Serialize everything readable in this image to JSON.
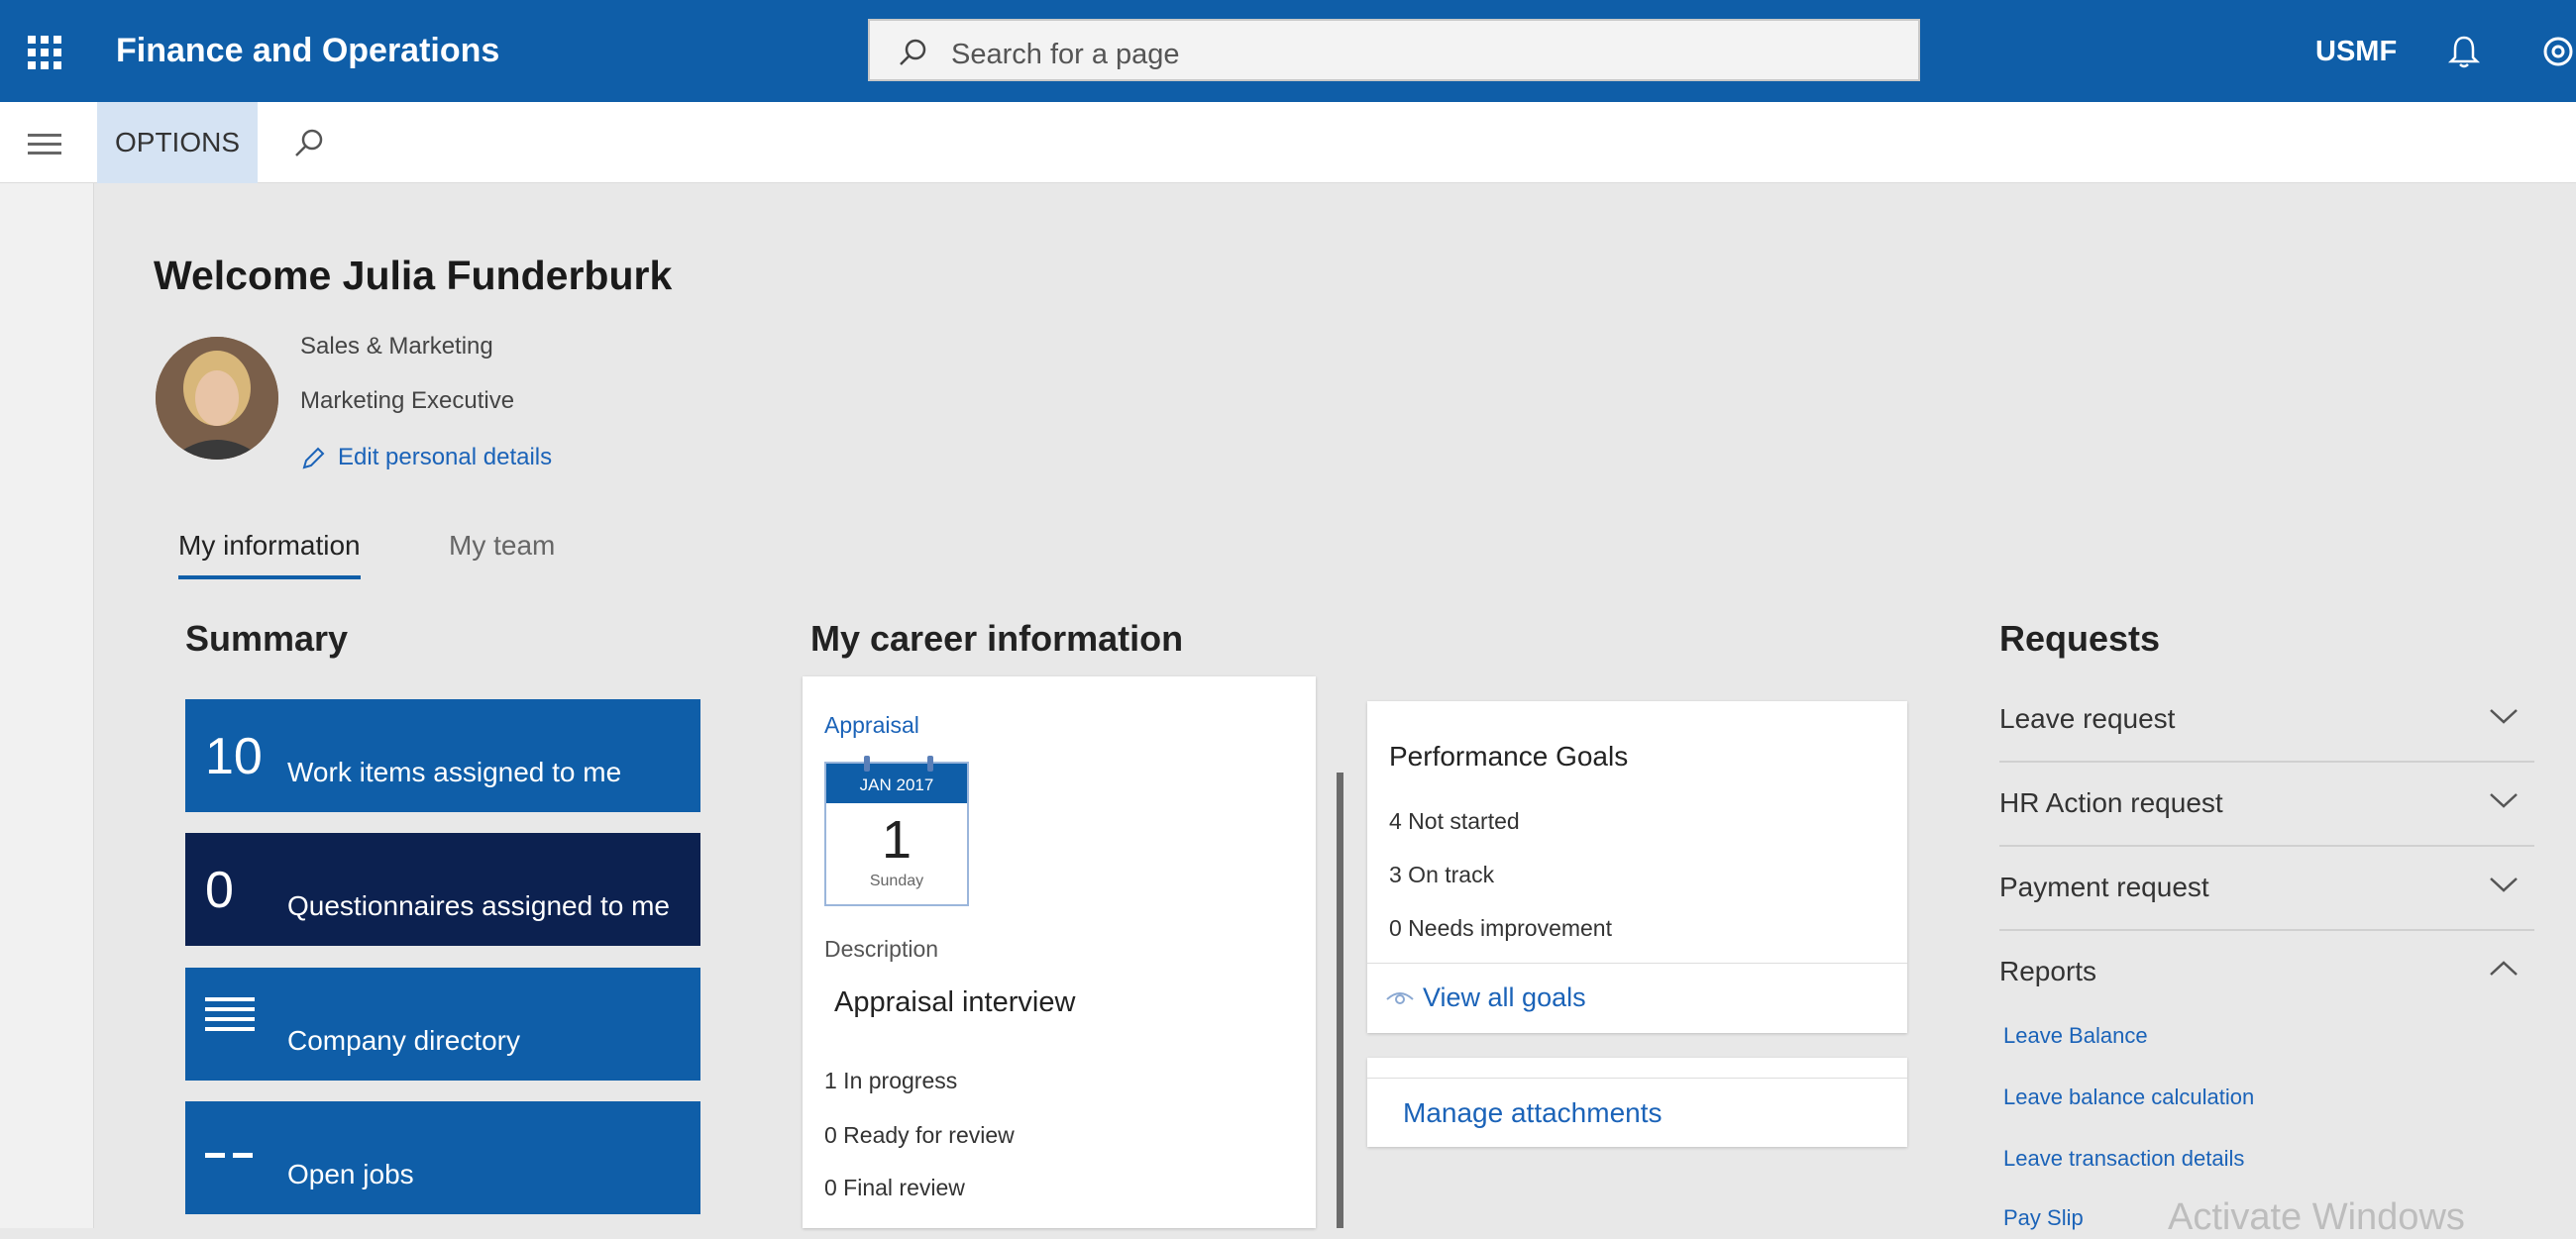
{
  "header": {
    "app_title": "Finance and Operations",
    "search_placeholder": "Search for a page",
    "company": "USMF"
  },
  "actionbar": {
    "options_label": "OPTIONS"
  },
  "profile": {
    "welcome": "Welcome Julia Funderburk",
    "department": "Sales & Marketing",
    "job_title": "Marketing Executive",
    "edit_link": "Edit personal details"
  },
  "tabs": [
    {
      "label": "My information",
      "active": true
    },
    {
      "label": "My team",
      "active": false
    }
  ],
  "summary": {
    "title": "Summary",
    "tiles": [
      {
        "count": "10",
        "label": "Work items assigned to me"
      },
      {
        "count": "0",
        "label": "Questionnaires assigned to me"
      },
      {
        "label": "Company directory"
      },
      {
        "label": "Open jobs"
      }
    ]
  },
  "career": {
    "title": "My career information",
    "appraisal": {
      "link": "Appraisal",
      "cal_month": "JAN 2017",
      "cal_day": "1",
      "cal_weekday": "Sunday",
      "description_label": "Description",
      "description_value": "Appraisal interview",
      "stats": [
        "1 In progress",
        "0 Ready for review",
        "0 Final review"
      ]
    },
    "goals": {
      "title": "Performance Goals",
      "stats": [
        "4 Not started",
        "3 On track",
        "0 Needs improvement"
      ],
      "view_link": "View all goals"
    },
    "attachments": {
      "link": "Manage attachments"
    }
  },
  "requests": {
    "title": "Requests",
    "items": [
      {
        "label": "Leave request",
        "expanded": false
      },
      {
        "label": "HR Action request",
        "expanded": false
      },
      {
        "label": "Payment request",
        "expanded": false
      },
      {
        "label": "Reports",
        "expanded": true
      }
    ],
    "reports": [
      "Leave Balance",
      "Leave balance calculation",
      "Leave transaction details",
      "Pay Slip"
    ]
  },
  "watermark": "Activate Windows",
  "colors": {
    "brand_blue": "#0f5ea8",
    "dark_navy": "#0c2150",
    "link_blue": "#1b63b8"
  }
}
